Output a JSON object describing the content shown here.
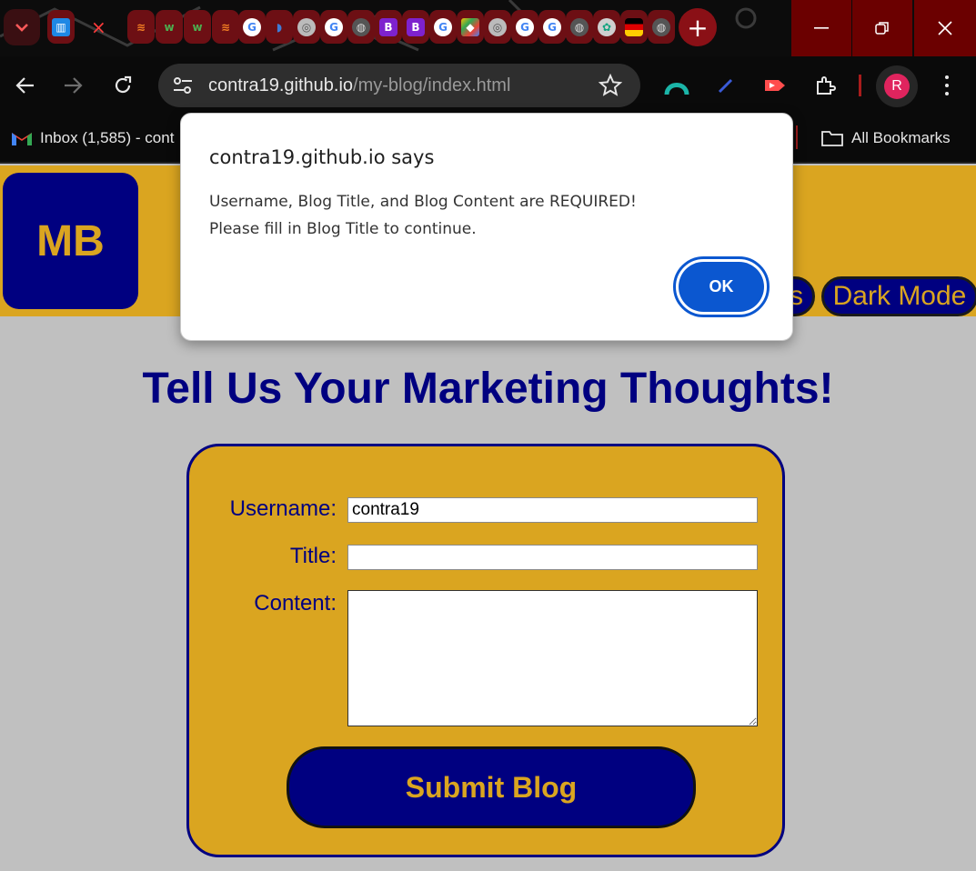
{
  "browser": {
    "url_host": "contra19.github.io",
    "url_path": "/my-blog/index.html",
    "bookmarks": {
      "gmail_label": "Inbox (1,585) - cont",
      "all_bookmarks_label": "All Bookmarks"
    },
    "profile_initial": "R",
    "tab_icon_letters": [
      "B",
      "B"
    ]
  },
  "site": {
    "logo_text": "MB",
    "nav_partial_label": "s",
    "dark_mode_label": "Dark Mode"
  },
  "main": {
    "title": "Tell Us Your Marketing Thoughts!",
    "form": {
      "username_label": "Username:",
      "username_value": "contra19",
      "title_label": "Title:",
      "title_value": "",
      "content_label": "Content:",
      "content_value": "",
      "submit_label": "Submit Blog"
    }
  },
  "dialog": {
    "title": "contra19.github.io says",
    "line1": "Username, Blog Title, and Blog Content are REQUIRED!",
    "line2": "Please fill in Blog Title to continue.",
    "ok_label": "OK"
  },
  "colors": {
    "gold": "#daa520",
    "navy": "#000080",
    "page_bg": "#c0c0c0",
    "tab_red": "#6d0f14",
    "dialog_accent": "#0b57d0"
  }
}
